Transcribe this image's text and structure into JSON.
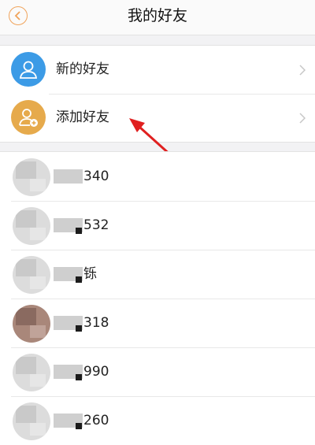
{
  "header": {
    "title": "我的好友"
  },
  "menu": [
    {
      "label": "新的好友",
      "icon": "user-icon"
    },
    {
      "label": "添加好友",
      "icon": "add-user-icon"
    }
  ],
  "friends": [
    {
      "name_visible": "340"
    },
    {
      "name_visible": "532"
    },
    {
      "name_visible": "铄"
    },
    {
      "name_visible": "318"
    },
    {
      "name_visible": "990"
    },
    {
      "name_visible": "260"
    }
  ],
  "colors": {
    "accent": "#f0a35a",
    "new_friend_icon": "#3c9be6",
    "add_friend_icon": "#e6aa4c",
    "annotation_arrow": "#e02020"
  }
}
